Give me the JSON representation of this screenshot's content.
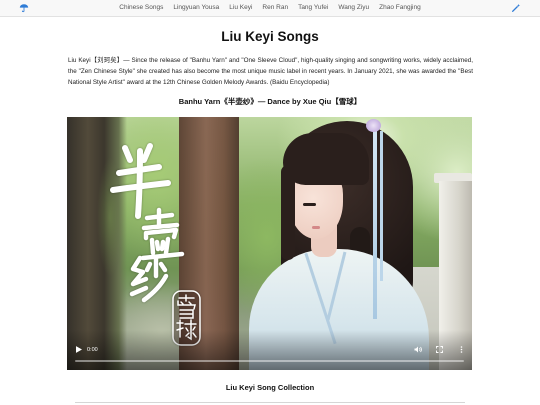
{
  "nav": {
    "left_icon": "umbrella-icon",
    "right_icon": "magic-wand-icon",
    "icon_color": "#2f7cd6",
    "items": [
      "Chinese Songs",
      "Lingyuan Yousa",
      "Liu Keyi",
      "Ren Ran",
      "Tang Yufei",
      "Wang Ziyu",
      "Zhao Fangjing"
    ]
  },
  "header": {
    "title": "Liu Keyi Songs"
  },
  "intro": {
    "text": "Liu Keyi【刘珂矣】— Since the release of \"Banhu Yarn\" and \"One Sleeve Cloud\", high-quality singing and songwriting works, widely acclaimed, the \"Zen Chinese Style\" she created has also become the most unique music label in recent years. In January 2021, she was awarded the \"Best National Style Artist\" award at the 12th Chinese Golden Melody Awards. (Baidu Encyclopedia)"
  },
  "featured": {
    "heading": "Banhu Yarn《半壶纱》— Dance by Xue Qiu【雪球】",
    "video": {
      "frame_title": "半壶纱",
      "frame_seal": "雪球",
      "current_time": "0:00",
      "progress": 0,
      "icons": {
        "play": "play-icon",
        "volume": "volume-icon",
        "fullscreen": "fullscreen-icon",
        "more": "more-options-icon"
      }
    }
  },
  "collection": {
    "heading": "Liu Keyi Song Collection"
  }
}
